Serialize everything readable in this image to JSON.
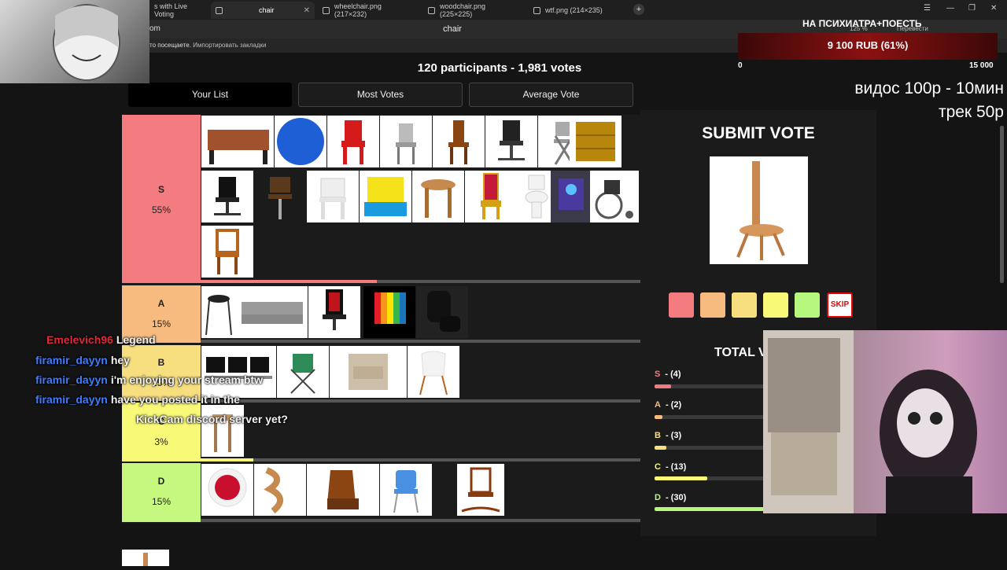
{
  "browser": {
    "tabs": [
      {
        "label": "s with Live Voting",
        "active": false
      },
      {
        "label": "chair",
        "active": true
      },
      {
        "label": "wheelchair.png (217×232)",
        "active": false
      },
      {
        "label": "woodchair.png (225×225)",
        "active": false
      },
      {
        "label": "wtf.png (214×235)",
        "active": false
      }
    ],
    "address_left": "om",
    "address_center": "chair",
    "bookmarks_bold": "то посещаете.",
    "bookmarks_text": "Импортировать закладки",
    "zoom": "125 %",
    "translate": "Перевести"
  },
  "header": {
    "stats": "120 participants - 1,981 votes",
    "tabs": [
      "Your List",
      "Most Votes",
      "Average Vote"
    ]
  },
  "tiers": [
    {
      "name": "S",
      "percent": "55%",
      "color": "#f47c80",
      "progress": 0.4
    },
    {
      "name": "A",
      "percent": "15%",
      "color": "#f7bb80",
      "progress": 0
    },
    {
      "name": "B",
      "percent": "15%",
      "color": "#f7df80",
      "progress": 0
    },
    {
      "name": "C",
      "percent": "3%",
      "color": "#f9f978",
      "progress": 0.12
    },
    {
      "name": "D",
      "percent": "15%",
      "color": "#c6f77e",
      "progress": 0
    }
  ],
  "vote": {
    "title": "SUBMIT VOTE",
    "skip": "SKIP",
    "swatches": [
      "#f47c80",
      "#f7bb80",
      "#f7df80",
      "#f9f978",
      "#b6f77e"
    ],
    "total_title": "TOTAL V",
    "rows": [
      {
        "letter": "S",
        "count": "(4)",
        "color": "#f47c80",
        "share": 0.15
      },
      {
        "letter": "A",
        "count": "(2)",
        "color": "#f7bb80",
        "share": 0.07
      },
      {
        "letter": "B",
        "count": "(3)",
        "color": "#f7df80",
        "share": 0.11
      },
      {
        "letter": "C",
        "count": "(13)",
        "color": "#f9f978",
        "share": 0.48
      },
      {
        "letter": "D",
        "count": "(30)",
        "color": "#b6f77e",
        "share": 1.0
      }
    ]
  },
  "overlay": {
    "donate_title": "НА ПСИХИАТРА+ПОЕСТЬ",
    "donate_amount": "9 100 RUB (61%)",
    "donate_min": "0",
    "donate_max": "15 000",
    "price_video": "видос 100р - 10мин",
    "price_track": "трек 50р"
  },
  "chat": [
    {
      "user": "Emelevich96",
      "message": "Legend",
      "red": true
    },
    {
      "user": "firamir_dayyn",
      "message": "hey",
      "red": false
    },
    {
      "user": "firamir_dayyn",
      "message": "i'm enjoying your stream btw",
      "red": false
    },
    {
      "user": "firamir_dayyn",
      "message": "have you posted it in the",
      "red": false
    },
    {
      "user": "",
      "message": "KickCam discord server yet?",
      "red": false
    }
  ]
}
